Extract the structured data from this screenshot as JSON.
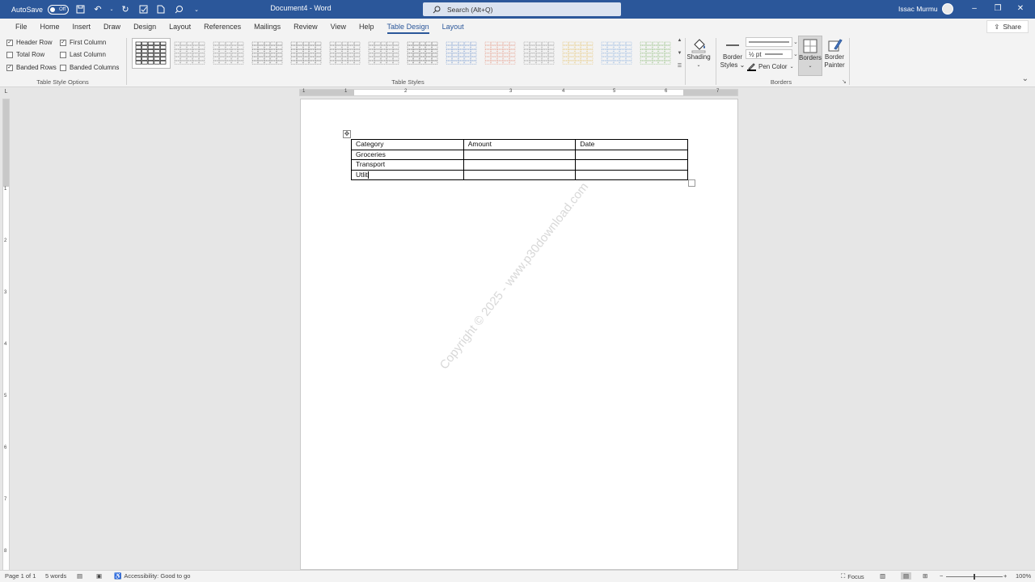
{
  "titlebar": {
    "autosave_label": "AutoSave",
    "autosave_state": "Off",
    "doc_title": "Document4  -  Word",
    "search_placeholder": "Search (Alt+Q)",
    "user_name": "Issac Murmu"
  },
  "tabs": [
    "File",
    "Home",
    "Insert",
    "Draw",
    "Design",
    "Layout",
    "References",
    "Mailings",
    "Review",
    "View",
    "Help",
    "Table Design",
    "Layout"
  ],
  "share_label": "Share",
  "table_style_options": {
    "items": [
      {
        "label": "Header Row",
        "checked": true
      },
      {
        "label": "First Column",
        "checked": true
      },
      {
        "label": "Total Row",
        "checked": false
      },
      {
        "label": "Last Column",
        "checked": false
      },
      {
        "label": "Banded Rows",
        "checked": true
      },
      {
        "label": "Banded Columns",
        "checked": false
      }
    ],
    "group_label": "Table Style Options"
  },
  "table_styles": {
    "group_label": "Table Styles",
    "thumb_colors": [
      "#222222",
      "#666666",
      "#666666",
      "#444444",
      "#444444",
      "#555555",
      "#555555",
      "#333333",
      "#4a78c2",
      "#e07a5f",
      "#777777",
      "#e0b341",
      "#6a9bd8",
      "#6aa84f"
    ]
  },
  "shading": {
    "label": "Shading"
  },
  "borders": {
    "border_styles_label": "Border\nStyles",
    "line_weight": "½ pt",
    "pen_color_label": "Pen Color",
    "borders_label": "Borders",
    "border_painter_label": "Border\nPainter",
    "group_label": "Borders"
  },
  "ruler": {
    "h_numbers": [
      "1",
      "1",
      "2",
      "3",
      "4",
      "5",
      "6",
      "7"
    ],
    "v_numbers": [
      "1",
      "2",
      "3",
      "4",
      "5",
      "6",
      "7",
      "8"
    ]
  },
  "document": {
    "table": [
      [
        "Category",
        "Amount",
        "Date"
      ],
      [
        "Groceries",
        "",
        ""
      ],
      [
        "Transport",
        "",
        ""
      ],
      [
        "Utlit",
        "",
        ""
      ]
    ],
    "watermark": "Copyright © 2025 - www.p30download.com"
  },
  "statusbar": {
    "page": "Page 1 of 1",
    "words": "5 words",
    "accessibility": "Accessibility: Good to go",
    "focus": "Focus",
    "zoom": "100%"
  }
}
